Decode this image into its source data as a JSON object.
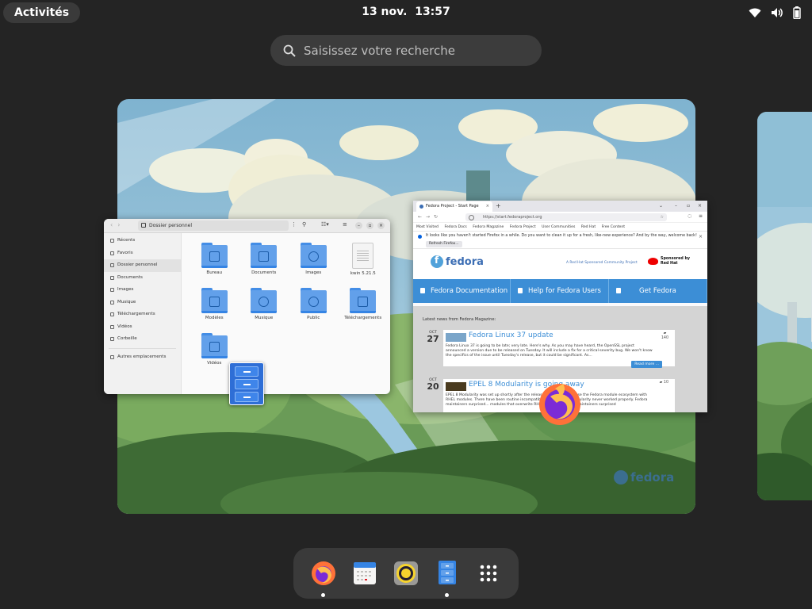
{
  "topbar": {
    "activities": "Activités",
    "date": "13 nov.",
    "time": "13:57",
    "tray": [
      "wifi-icon",
      "volume-icon",
      "battery-icon"
    ]
  },
  "search": {
    "placeholder": "Saisissez votre recherche"
  },
  "files": {
    "path": "Dossier personnel",
    "sidebar": [
      "Récents",
      "Favoris",
      "Dossier personnel",
      "Documents",
      "Images",
      "Musique",
      "Téléchargements",
      "Vidéos",
      "Corbeille",
      "Autres emplacements"
    ],
    "items": [
      "Bureau",
      "Documents",
      "Images",
      "kwin 5.21.5",
      "Modèles",
      "Musique",
      "Public",
      "Téléchargements",
      "Vidéos"
    ]
  },
  "firefox": {
    "tab_title": "Fedora Project - Start Page",
    "url": "https://start.fedoraproject.org",
    "bookmarks": [
      "Most Visited",
      "Fedora Docs",
      "Fedora Magazine",
      "Fedora Project",
      "User Communities",
      "Red Hat",
      "Free Content"
    ],
    "notice": "It looks like you haven't started Firefox in a while. Do you want to clean it up for a fresh, like-new experience? And by the way, welcome back!",
    "notice_button": "Refresh Firefox...",
    "brand": "fedora",
    "sponsor_text": "A Red Hat Sponsored Community Project",
    "sponsored_by": "Sponsored by",
    "redhat": "Red Hat",
    "menu": [
      "Fedora Documentation",
      "Help for Fedora Users",
      "Get Fedora"
    ],
    "latest": "Latest news from Fedora Magazine:",
    "news": [
      {
        "month": "OCT",
        "day": "27",
        "title": "Fedora Linux 37 update",
        "comments": "140",
        "text": "Fedora Linux 37 is going to be late; very late. Here's why. As you may have heard, the OpenSSL project announced a version due to be released on Tuesday. It will include a fix for a critical-severity bug. We won't know the specifics of the issue until Tuesday's release, but it could be significant. As...",
        "more": "Read more ..."
      },
      {
        "month": "OCT",
        "day": "20",
        "title": "EPEL 8 Modularity is going away",
        "comments": "10",
        "text": "EPEL 8 Modularity was set up shortly after the release. It attempted to use the Fedora module ecosystem with RHEL modules. There have been routine incompatibilities with RHEL modularity never worked properly. Fedora maintainers surprised... modules that overwrite RHEL modules. Fedora maintainers surprised"
      }
    ]
  },
  "wallpaper_brand": "fedora",
  "dash": [
    "firefox-icon",
    "calendar-icon",
    "rhythmbox-icon",
    "files-icon",
    "app-grid-icon"
  ]
}
